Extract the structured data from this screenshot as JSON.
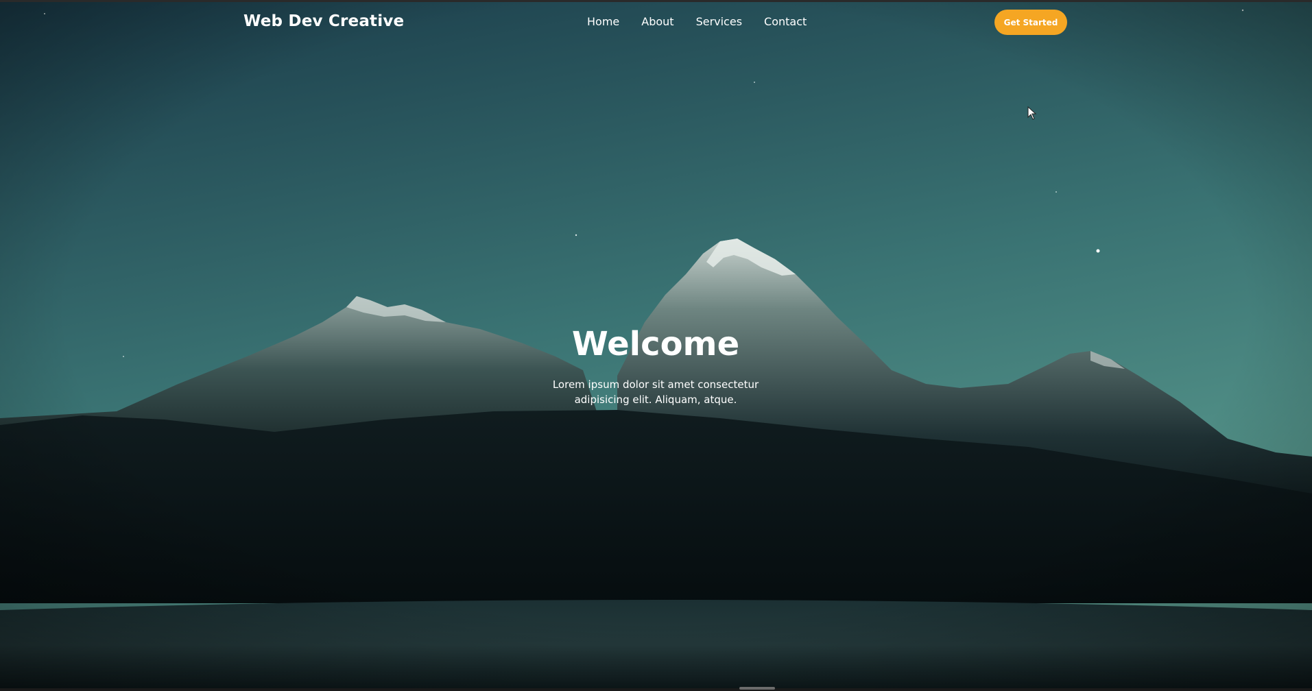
{
  "brand": {
    "logo_text": "Web Dev Creative"
  },
  "nav": {
    "items": [
      {
        "label": "Home"
      },
      {
        "label": "About"
      },
      {
        "label": "Services"
      },
      {
        "label": "Contact"
      }
    ],
    "cta_label": "Get Started"
  },
  "hero": {
    "title": "Welcome",
    "subtitle": "Lorem ipsum dolor sit amet consectetur adipisicing elit. Aliquam, atque.",
    "background_icon": "mountain-night-landscape"
  },
  "colors": {
    "accent": "#f5a623",
    "sky_top": "#1c3f4c",
    "sky_bottom": "#4a8a83",
    "text": "#ffffff"
  }
}
